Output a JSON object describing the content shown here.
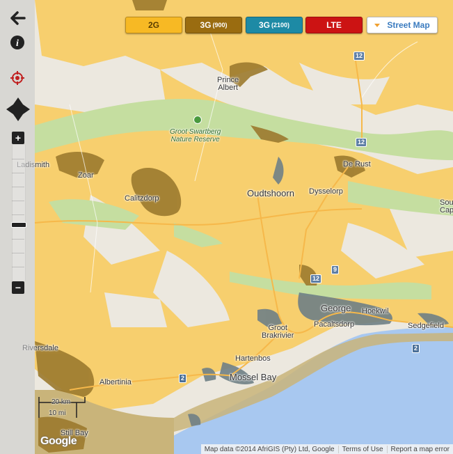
{
  "colors": {
    "coverage_2g": "#f7cf6e",
    "coverage_3g_900": "#9c7a2e",
    "coverage_3g_2100": "#6f8086",
    "coverage_lte": "#c92420",
    "sea": "#a8c8f0",
    "park": "#c5dea0",
    "land": "#ece8df"
  },
  "toolbar": {
    "btn_2g": {
      "label": "2G",
      "color": "#f7b924",
      "text_color": "#5a3d00"
    },
    "btn_3g900": {
      "label": "3G",
      "sub": "(900)",
      "color": "#9a6c10"
    },
    "btn_3g2100": {
      "label": "3G",
      "sub": "(2100)",
      "color": "#1d8aa5"
    },
    "btn_lte": {
      "label": "LTE",
      "color": "#cc1313"
    },
    "street_map": {
      "label": "Street Map"
    }
  },
  "controls": {
    "back_icon": "arrow-left",
    "info_icon": "info",
    "locate_icon": "crosshair",
    "pan_icon": "four-way-arrows",
    "zoom_in": "+",
    "zoom_out": "−"
  },
  "places": {
    "prince_albert": "Prince\nAlbert",
    "groot_swartberg": "Groot Swartberg\nNature Reserve",
    "ladismith": "Ladismith",
    "zoar": "Zoar",
    "calitzdorp": "Calitzdorp",
    "oudtshoorn": "Oudtshoorn",
    "dysseldorp": "Dysselorp",
    "de_rust": "De Rust",
    "south_cape": "Sou\nCape",
    "george": "George",
    "hoekwil": "Hoekwil",
    "pacaltsdorp": "Pacaltsdorp",
    "sedgefield": "Sedgefield",
    "groot_brakrivier": "Groot\nBrakrivier",
    "hartenbos": "Hartenbos",
    "mossel_bay": "Mossel Bay",
    "albertinia": "Albertinia",
    "riversdale": "Riversdale",
    "still_bay": "Still Bay"
  },
  "road_shields": {
    "r12a": "12",
    "r12b": "12",
    "r12c": "12",
    "r9": "9",
    "r2a": "2",
    "r2b": "2"
  },
  "scale": {
    "km": "20 km",
    "mi": "10 mi"
  },
  "attribution": {
    "data": "Map data ©2014 AfriGIS (Pty) Ltd, Google",
    "terms": "Terms of Use",
    "report": "Report a map error"
  },
  "logo": "Google"
}
